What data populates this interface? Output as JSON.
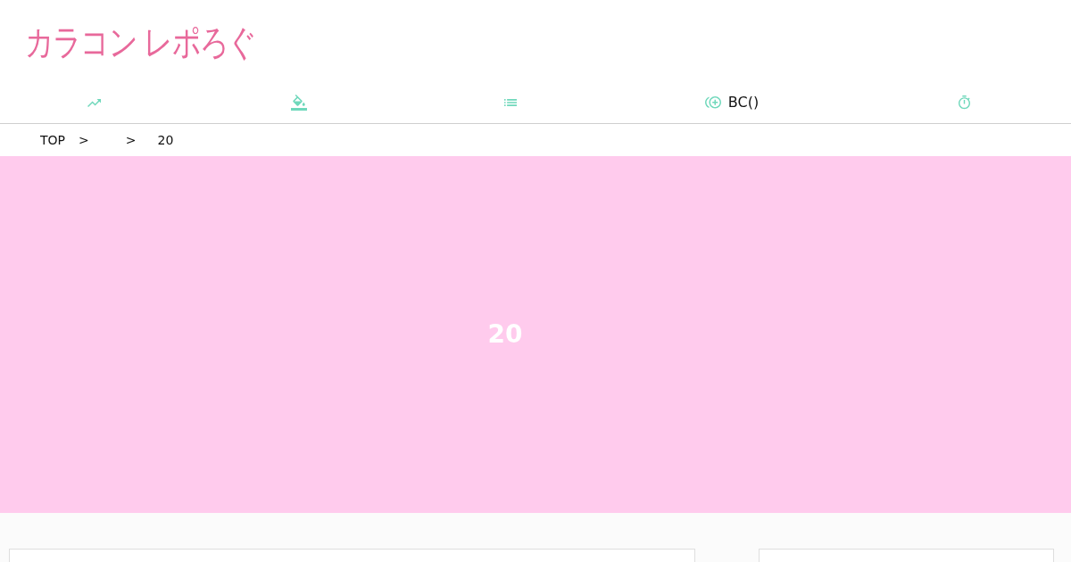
{
  "header": {
    "logo": "カラコン レポろぐ"
  },
  "nav": {
    "items": [
      {
        "kind": "trend"
      },
      {
        "kind": "fill"
      },
      {
        "kind": "list"
      },
      {
        "kind": "coin",
        "label": "BC()"
      },
      {
        "kind": "timer"
      }
    ]
  },
  "breadcrumb": {
    "items": [
      {
        "kind": "link",
        "text": "TOP"
      },
      {
        "kind": "separator",
        "text": ">"
      },
      {
        "kind": "separator",
        "text": ">"
      },
      {
        "kind": "current",
        "text": "20"
      }
    ]
  },
  "hero": {
    "title": "20"
  }
}
